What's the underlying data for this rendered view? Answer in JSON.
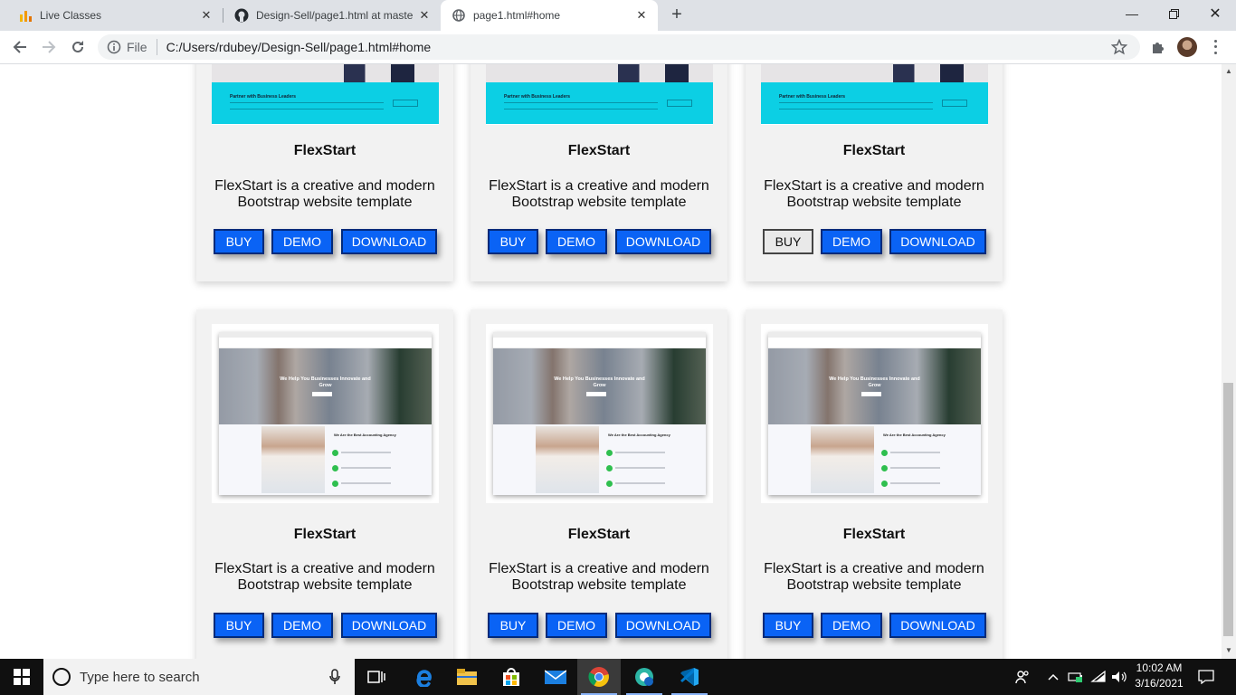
{
  "browser": {
    "tabs": [
      {
        "title": "Live Classes",
        "icon": "analytics-bars-icon",
        "active": false
      },
      {
        "title": "Design-Sell/page1.html at maste",
        "icon": "github-icon",
        "active": false
      },
      {
        "title": "page1.html#home",
        "icon": "globe-icon",
        "active": true
      }
    ],
    "new_tab_label": "+",
    "omnibox": {
      "scheme_label": "File",
      "url": "C:/Users/rdubey/Design-Sell/page1.html#home"
    }
  },
  "page": {
    "top_row": [
      {
        "title": "FlexStart",
        "description": "FlexStart is a creative and modern Bootstrap website template",
        "buttons": [
          "BUY",
          "DEMO",
          "DOWNLOAD"
        ],
        "thumb_caption": "Partner with Business Leaders"
      },
      {
        "title": "FlexStart",
        "description": "FlexStart is a creative and modern Bootstrap website template",
        "buttons": [
          "BUY",
          "DEMO",
          "DOWNLOAD"
        ],
        "thumb_caption": "Partner with Business Leaders"
      },
      {
        "title": "FlexStart",
        "description": "FlexStart is a creative and modern Bootstrap website template",
        "buttons": [
          "BUY",
          "DEMO",
          "DOWNLOAD"
        ],
        "thumb_caption": "Partner with Business Leaders"
      }
    ],
    "bottom_row": [
      {
        "title": "FlexStart",
        "description": "FlexStart is a creative and modern Bootstrap website template",
        "buttons": [
          "BUY",
          "DEMO",
          "DOWNLOAD"
        ],
        "thumb_headline": "We Help You Businesses Innovate and Grow",
        "thumb_subheading": "We Are the Best Accounting Agency"
      },
      {
        "title": "FlexStart",
        "description": "FlexStart is a creative and modern Bootstrap website template",
        "buttons": [
          "BUY",
          "DEMO",
          "DOWNLOAD"
        ],
        "thumb_headline": "We Help You Businesses Innovate and Grow",
        "thumb_subheading": "We Are the Best Accounting Agency"
      },
      {
        "title": "FlexStart",
        "description": "FlexStart is a creative and modern Bootstrap website template",
        "buttons": [
          "BUY",
          "DEMO",
          "DOWNLOAD"
        ],
        "thumb_headline": "We Help You Businesses Innovate and Grow",
        "thumb_subheading": "We Are the Best Accounting Agency"
      }
    ],
    "colors": {
      "button_bg": "#0a63f5",
      "button_border": "#022a7a",
      "card_bg": "#f2f2f2",
      "thumb_cyan": "#0ccfe4"
    }
  },
  "taskbar": {
    "search_placeholder": "Type here to search",
    "time": "10:02 AM",
    "date": "3/16/2021",
    "apps": [
      "task-view-icon",
      "edge-icon",
      "file-explorer-icon",
      "store-icon",
      "mail-icon",
      "chrome-icon",
      "edge-beta-icon",
      "vscode-icon"
    ]
  }
}
